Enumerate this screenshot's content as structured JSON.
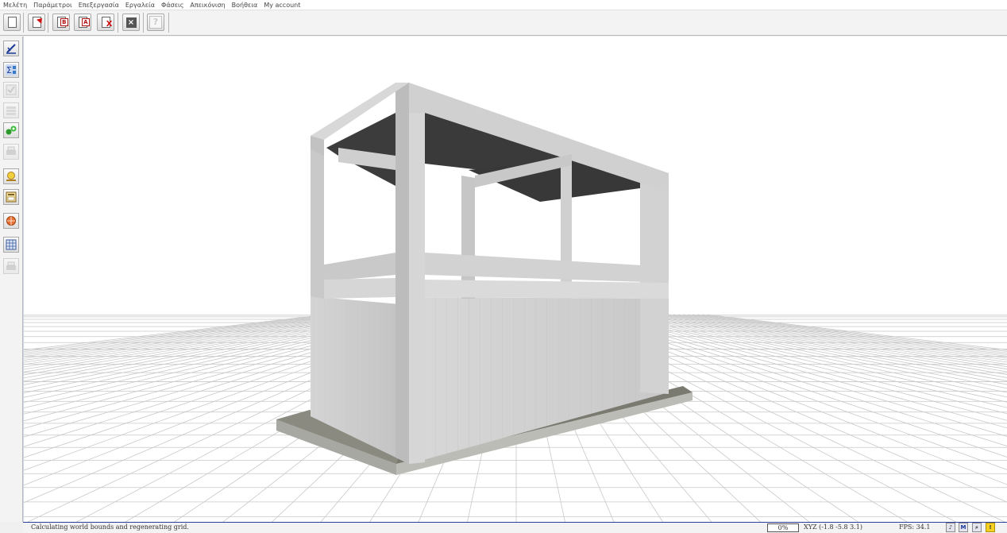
{
  "menu": {
    "items": [
      {
        "label": "Μελέτη"
      },
      {
        "label": "Παράμετροι"
      },
      {
        "label": "Επεξεργασία"
      },
      {
        "label": "Εργαλεία"
      },
      {
        "label": "Φάσεις"
      },
      {
        "label": "Απεικόνιση"
      },
      {
        "label": "Βοήθεια"
      },
      {
        "label": "My account"
      }
    ]
  },
  "toolbar": {
    "buttons": [
      {
        "icon": "new-document-icon"
      },
      {
        "icon": "open-document-icon"
      },
      {
        "icon": "document-b-icon",
        "tag": "B"
      },
      {
        "icon": "document-a-icon",
        "tag": "A"
      },
      {
        "icon": "delete-document-icon",
        "tag": "X"
      },
      {
        "icon": "close-icon",
        "tag": "×"
      },
      {
        "icon": "help-icon",
        "tag": "?"
      }
    ]
  },
  "left_toolbar": {
    "buttons": [
      {
        "icon": "draw-edit-icon",
        "enabled": true
      },
      {
        "icon": "sum-calculation-icon",
        "enabled": true
      },
      {
        "icon": "check-icon",
        "enabled": false
      },
      {
        "icon": "layers-icon",
        "enabled": false
      },
      {
        "icon": "links-icon",
        "enabled": true
      },
      {
        "icon": "print-icon",
        "enabled": false
      },
      {
        "icon": "measure-icon",
        "enabled": true
      },
      {
        "icon": "panel-icon",
        "enabled": true
      },
      {
        "icon": "rotate-globe-icon",
        "enabled": true
      },
      {
        "icon": "grid-structure-icon",
        "enabled": true
      },
      {
        "icon": "printer-icon",
        "enabled": false
      }
    ]
  },
  "viewport": {
    "content": "3D concrete structure on perspective grid",
    "colors": {
      "concrete": "#cfcfcf",
      "slab_underside": "#3a3a3a",
      "grid": "#c8c8c8",
      "base": "#8a8a80"
    }
  },
  "status": {
    "message": "Calculating world bounds and regenerating grid.",
    "progress": "0%",
    "coords": "XYZ (-1.8 -5.8 3.1)",
    "fps": "FPS: 34.1",
    "icons": [
      "speaker-icon",
      "m-icon",
      "zoom-icon",
      "warning-icon"
    ]
  }
}
